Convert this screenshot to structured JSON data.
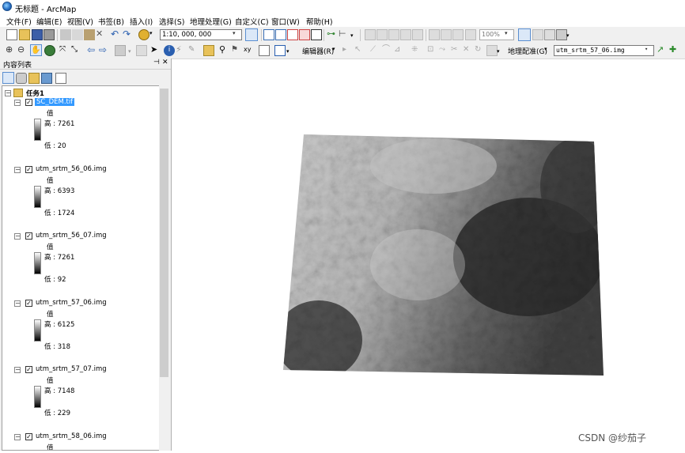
{
  "app": {
    "title": "无标题 - ArcMap"
  },
  "menu": [
    "文件(F)",
    "编辑(E)",
    "视图(V)",
    "书签(B)",
    "插入(I)",
    "选择(S)",
    "地理处理(G)",
    "自定义(C)",
    "窗口(W)",
    "帮助(H)"
  ],
  "toolbar": {
    "scale": "1:10, 000, 000",
    "zoom": "100%",
    "editor_label": "编辑器(R)",
    "georef_label": "地理配准(G)",
    "georef_layer": "utm_srtm_57_06.img"
  },
  "toc": {
    "title": "内容列表",
    "group": "任务1",
    "layers": [
      {
        "name": "SC_DEM.tif",
        "value_label": "值",
        "high": "高 : 7261",
        "low": "低 : 20"
      },
      {
        "name": "utm_srtm_56_06.img",
        "value_label": "值",
        "high": "高 : 6393",
        "low": "低 : 1724"
      },
      {
        "name": "utm_srtm_56_07.img",
        "value_label": "值",
        "high": "高 : 7261",
        "low": "低 : 92"
      },
      {
        "name": "utm_srtm_57_06.img",
        "value_label": "值",
        "high": "高 : 6125",
        "low": "低 : 318"
      },
      {
        "name": "utm_srtm_57_07.img",
        "value_label": "值",
        "high": "高 : 7148",
        "low": "低 : 229"
      },
      {
        "name": "utm_srtm_58_06.img",
        "value_label": "值"
      }
    ]
  },
  "watermark": "CSDN @纱茄子",
  "colors": {
    "selection": "#3399ff",
    "toolbar_bg": "#f0f0f0"
  }
}
